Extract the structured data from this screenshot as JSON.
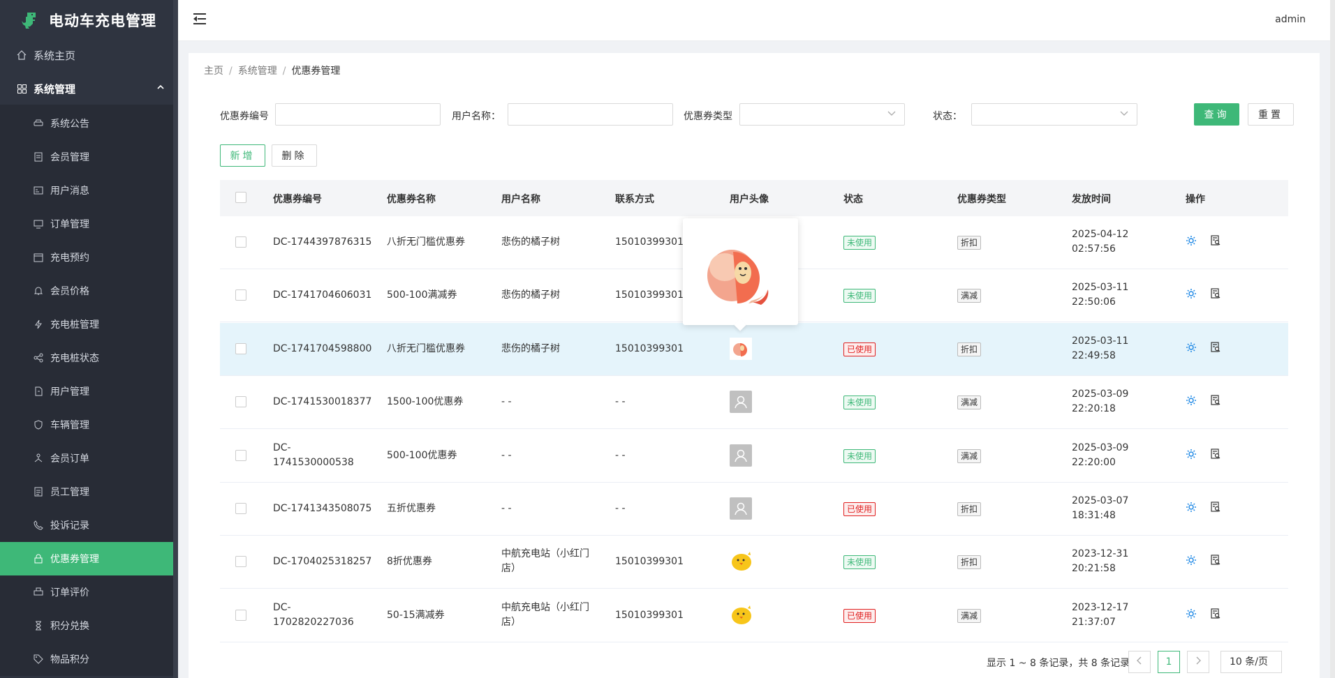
{
  "app": {
    "title": "电动车充电管理"
  },
  "sidebar": {
    "home": {
      "label": "系统主页",
      "icon": "home-icon"
    },
    "group": {
      "label": "系统管理",
      "icon": "grid-icon"
    },
    "items": [
      {
        "label": "系统公告",
        "icon": "car-icon"
      },
      {
        "label": "会员管理",
        "icon": "doc-icon"
      },
      {
        "label": "用户消息",
        "icon": "card-icon"
      },
      {
        "label": "订单管理",
        "icon": "monitor-icon"
      },
      {
        "label": "充电预约",
        "icon": "calendar-icon"
      },
      {
        "label": "会员价格",
        "icon": "bell-icon"
      },
      {
        "label": "充电桩管理",
        "icon": "bolt-icon"
      },
      {
        "label": "充电桩状态",
        "icon": "share-icon"
      },
      {
        "label": "用户管理",
        "icon": "file-icon"
      },
      {
        "label": "车辆管理",
        "icon": "shield-icon"
      },
      {
        "label": "会员订单",
        "icon": "sitemap-icon"
      },
      {
        "label": "员工管理",
        "icon": "list-icon"
      },
      {
        "label": "投诉记录",
        "icon": "phone-icon"
      },
      {
        "label": "优惠券管理",
        "icon": "lock-icon",
        "active": true
      },
      {
        "label": "订单评价",
        "icon": "printer-icon"
      },
      {
        "label": "积分兑换",
        "icon": "hourglass-icon"
      },
      {
        "label": "物品积分",
        "icon": "tag-icon"
      }
    ]
  },
  "topbar": {
    "user": "admin"
  },
  "breadcrumb": [
    "主页",
    "系统管理",
    "优惠券管理"
  ],
  "filters": {
    "code_label": "优惠券编号",
    "user_label": "用户名称：",
    "type_label": "优惠券类型",
    "status_label": "状态：",
    "code_value": "",
    "user_value": "",
    "type_value": "",
    "status_value": ""
  },
  "buttons": {
    "search": "查询",
    "reset": "重置",
    "add": "新增",
    "delete": "删除"
  },
  "table": {
    "headers": [
      "优惠券编号",
      "优惠券名称",
      "用户名称",
      "联系方式",
      "用户头像",
      "状态",
      "优惠券类型",
      "发放时间",
      "操作"
    ],
    "rows": [
      {
        "code": "DC-1744397876315",
        "name": "八折无门槛优惠券",
        "user": "悲伤的橘子树",
        "phone": "15010399301",
        "avatar": "peach",
        "status": "未使用",
        "type": "折扣",
        "date": "2025-04-12",
        "time": "02:57:56"
      },
      {
        "code": "DC-1741704606031",
        "name": "500-100满减券",
        "user": "悲伤的橘子树",
        "phone": "15010399301",
        "avatar": "peach",
        "status": "未使用",
        "type": "满减",
        "date": "2025-03-11",
        "time": "22:50:06"
      },
      {
        "code": "DC-1741704598800",
        "name": "八折无门槛优惠券",
        "user": "悲伤的橘子树",
        "phone": "15010399301",
        "avatar": "peach",
        "status": "已使用",
        "type": "折扣",
        "date": "2025-03-11",
        "time": "22:49:58"
      },
      {
        "code": "DC-1741530018377",
        "name": "1500-100优惠券",
        "user": "- -",
        "phone": "- -",
        "avatar": "default",
        "status": "未使用",
        "type": "满减",
        "date": "2025-03-09",
        "time": "22:20:18"
      },
      {
        "code": "DC-1741530000538",
        "code_l1": "DC-",
        "code_l2": "1741530000538",
        "name": "500-100优惠券",
        "user": "- -",
        "phone": "- -",
        "avatar": "default",
        "status": "未使用",
        "type": "满减",
        "date": "2025-03-09",
        "time": "22:20:00"
      },
      {
        "code": "DC-1741343508075",
        "name": "五折优惠券",
        "user": "- -",
        "phone": "- -",
        "avatar": "default",
        "status": "已使用",
        "type": "折扣",
        "date": "2025-03-07",
        "time": "18:31:48"
      },
      {
        "code": "DC-1704025318257",
        "name": "8折优惠券",
        "user_l1": "中航充电站（小红门",
        "user_l2": "店）",
        "phone": "15010399301",
        "avatar": "chick",
        "status": "未使用",
        "type": "折扣",
        "date": "2023-12-31",
        "time": "20:21:58"
      },
      {
        "code": "DC-1702820227036",
        "code_l1": "DC-",
        "code_l2": "1702820227036",
        "name": "50-15满减券",
        "user_l1": "中航充电站（小红门",
        "user_l2": "店）",
        "phone": "15010399301",
        "avatar": "chick",
        "status": "已使用",
        "type": "满减",
        "date": "2023-12-17",
        "time": "21:37:07"
      }
    ]
  },
  "pagination": {
    "summary": "显示 1 ~ 8 条记录，共 8 条记录",
    "current": "1",
    "page_size": "10 条/页"
  },
  "colors": {
    "brand": "#3eb878",
    "sidebar": "#2f3440",
    "danger": "#e02020",
    "highlight": "#e5f4fb"
  }
}
